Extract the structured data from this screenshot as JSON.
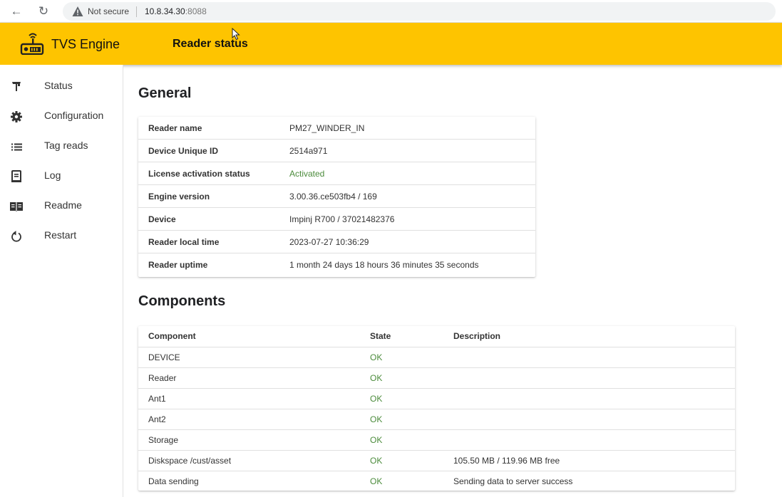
{
  "browser": {
    "not_secure": "Not secure",
    "url_host": "10.8.34.30",
    "url_port": ":8088"
  },
  "header": {
    "app_name": "TVS Engine",
    "page_title": "Reader status",
    "background": "#fec400"
  },
  "sidebar": {
    "items": [
      {
        "label": "Status",
        "icon": "signal-tower-icon"
      },
      {
        "label": "Configuration",
        "icon": "gear-icon"
      },
      {
        "label": "Tag reads",
        "icon": "list-icon"
      },
      {
        "label": "Log",
        "icon": "log-icon"
      },
      {
        "label": "Readme",
        "icon": "book-icon"
      },
      {
        "label": "Restart",
        "icon": "restart-icon"
      }
    ]
  },
  "general": {
    "title": "General",
    "rows": [
      {
        "key": "Reader name",
        "value": "PM27_WINDER_IN"
      },
      {
        "key": "Device Unique ID",
        "value": "2514a971"
      },
      {
        "key": "License activation status",
        "value": "Activated"
      },
      {
        "key": "Engine version",
        "value": "3.00.36.ce503fb4 / 169"
      },
      {
        "key": "Device",
        "value": "Impinj R700 / 37021482376"
      },
      {
        "key": "Reader local time",
        "value": "2023-07-27 10:36:29"
      },
      {
        "key": "Reader uptime",
        "value": "1 month 24 days 18 hours 36 minutes 35 seconds"
      }
    ]
  },
  "components": {
    "title": "Components",
    "headers": {
      "component": "Component",
      "state": "State",
      "description": "Description"
    },
    "rows": [
      {
        "component": "DEVICE",
        "state": "OK",
        "description": ""
      },
      {
        "component": "Reader",
        "state": "OK",
        "description": ""
      },
      {
        "component": "Ant1",
        "state": "OK",
        "description": ""
      },
      {
        "component": "Ant2",
        "state": "OK",
        "description": ""
      },
      {
        "component": "Storage",
        "state": "OK",
        "description": ""
      },
      {
        "component": "Diskspace /cust/asset",
        "state": "OK",
        "description": "105.50 MB / 119.96 MB free"
      },
      {
        "component": "Data sending",
        "state": "OK",
        "description": "Sending data to server success"
      }
    ]
  },
  "colors": {
    "ok_green": "#4b8b3b",
    "accent": "#fec400"
  }
}
